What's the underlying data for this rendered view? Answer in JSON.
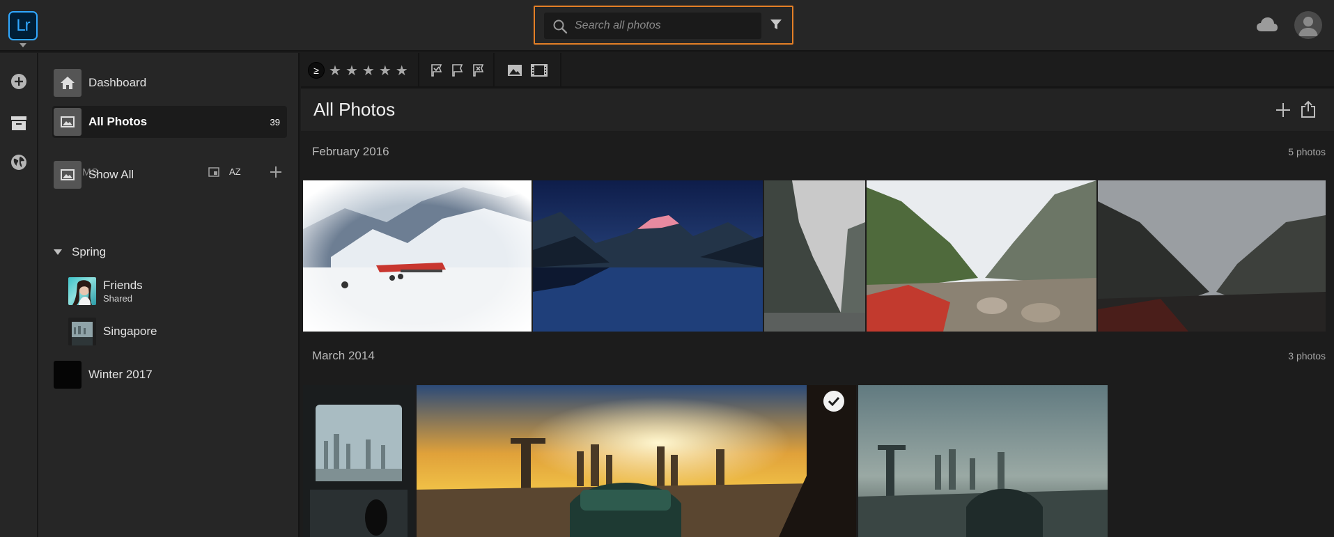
{
  "app": {
    "logo_text": "Lr"
  },
  "search": {
    "placeholder": "Search all photos"
  },
  "sidebar": {
    "dashboard_label": "Dashboard",
    "all_photos_label": "All Photos",
    "all_photos_count": "39",
    "albums_label": "ALBUMS",
    "sort_label": "AZ",
    "show_all_label": "Show All",
    "folder_name": "Spring",
    "albums": [
      {
        "name": "Friends",
        "sub": "Shared"
      },
      {
        "name": "Singapore"
      }
    ],
    "winter_label": "Winter 2017"
  },
  "toolbar": {
    "rating_operator": "≥",
    "stars": [
      "★",
      "★",
      "★",
      "★",
      "★"
    ]
  },
  "main": {
    "title": "All Photos",
    "groups": [
      {
        "title": "February 2016",
        "count": "5 photos"
      },
      {
        "title": "March 2014",
        "count": "3 photos"
      }
    ]
  },
  "colors": {
    "search_highlight": "#e47f26",
    "lr_blue": "#31a8ff",
    "background": "#1c1c1c",
    "panel": "#262626"
  }
}
